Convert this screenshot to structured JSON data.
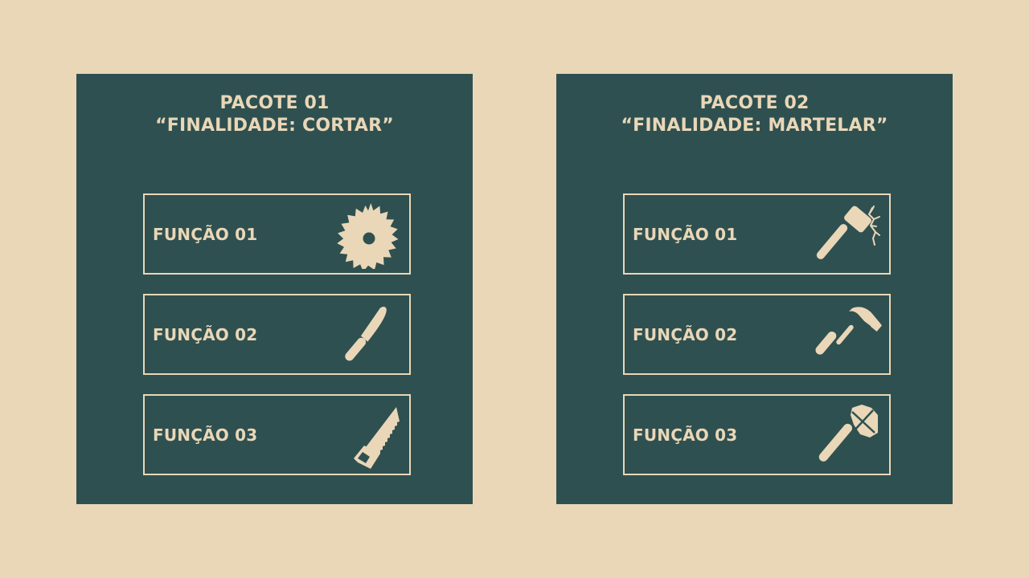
{
  "colors": {
    "background": "#E9D7B8",
    "panel": "#2F5050",
    "accent": "#E9D7B8"
  },
  "packages": [
    {
      "title_line1": "PACOTE 01",
      "title_line2": "“FINALIDADE: CORTAR”",
      "functions": [
        {
          "label": "FUNÇÃO 01",
          "icon": "circular-saw-blade-icon"
        },
        {
          "label": "FUNÇÃO 02",
          "icon": "knife-icon"
        },
        {
          "label": "FUNÇÃO 03",
          "icon": "hand-saw-icon"
        }
      ]
    },
    {
      "title_line1": "PACOTE 02",
      "title_line2": "“FINALIDADE: MARTELAR”",
      "functions": [
        {
          "label": "FUNÇÃO 01",
          "icon": "mallet-icon"
        },
        {
          "label": "FUNÇÃO 02",
          "icon": "claw-hammer-icon"
        },
        {
          "label": "FUNÇÃO 03",
          "icon": "stone-hammer-icon"
        }
      ]
    }
  ]
}
